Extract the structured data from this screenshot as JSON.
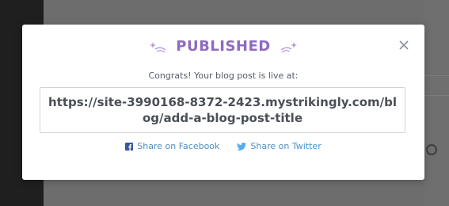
{
  "dialog": {
    "title": "PUBLISHED",
    "subtitle": "Congrats! Your blog post is live at:",
    "url": "https://site-3990168-8372-2423.mystrikingly.com/blog/add-a-blog-post-title",
    "close_icon": "close-icon",
    "decor_icon": "shooting-star-icon"
  },
  "share": {
    "facebook": {
      "label": "Share on Facebook",
      "icon": "facebook-icon"
    },
    "twitter": {
      "label": "Share on Twitter",
      "icon": "twitter-icon"
    }
  },
  "colors": {
    "accent": "#8e6bbf",
    "link": "#4d8fc4",
    "overlay": "#6d6d6d"
  }
}
